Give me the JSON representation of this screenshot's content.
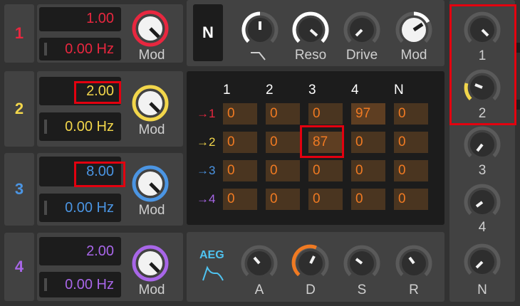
{
  "operators": [
    {
      "number": "1",
      "ratio": "1.00",
      "freq": "0.00 Hz",
      "mod_label": "Mod",
      "color": "#e8273f"
    },
    {
      "number": "2",
      "ratio": "2.00",
      "freq": "0.00 Hz",
      "mod_label": "Mod",
      "color": "#f2d64b"
    },
    {
      "number": "3",
      "ratio": "8.00",
      "freq": "0.00 Hz",
      "mod_label": "Mod",
      "color": "#4b95e3"
    },
    {
      "number": "4",
      "ratio": "2.00",
      "freq": "0.00 Hz",
      "mod_label": "Mod",
      "color": "#a866e8"
    }
  ],
  "filter": {
    "mode_button": "N",
    "knob_labels": [
      "",
      "Reso",
      "Drive",
      "Mod"
    ]
  },
  "matrix": {
    "col_headers": [
      "1",
      "2",
      "3",
      "4",
      "N"
    ],
    "rows": [
      {
        "label": "→1",
        "color": "#e8273f",
        "values": [
          "0",
          "0",
          "0",
          "97",
          "0"
        ]
      },
      {
        "label": "→2",
        "color": "#f2d64b",
        "values": [
          "0",
          "0",
          "87",
          "0",
          "0"
        ]
      },
      {
        "label": "→3",
        "color": "#4b95e3",
        "values": [
          "0",
          "0",
          "0",
          "0",
          "0"
        ]
      },
      {
        "label": "→4",
        "color": "#a866e8",
        "values": [
          "0",
          "0",
          "0",
          "0",
          "0"
        ]
      }
    ]
  },
  "aeg": {
    "label": "AEG",
    "color": "#4fc3f0",
    "knob_labels": [
      "A",
      "D",
      "S",
      "R"
    ]
  },
  "output_levels": {
    "labels": [
      "1",
      "2",
      "3",
      "4",
      "N"
    ]
  }
}
